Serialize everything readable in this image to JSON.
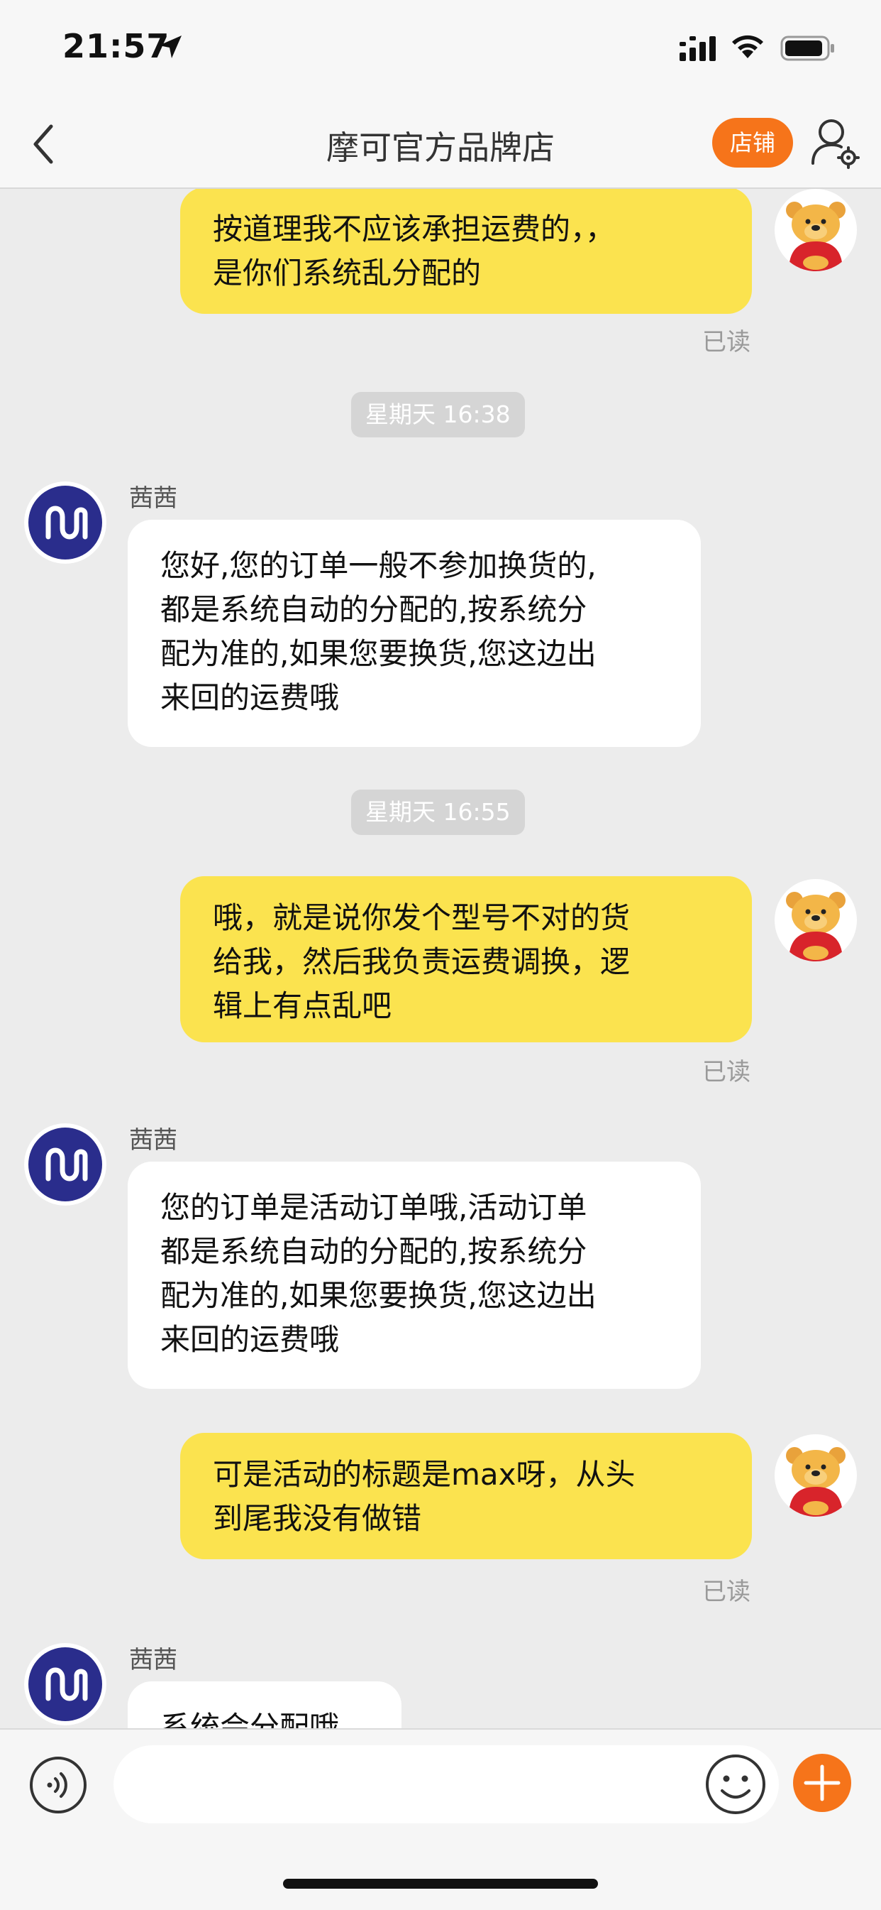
{
  "status_bar": {
    "time": "21:57"
  },
  "nav": {
    "title": "摩可官方品牌店",
    "shop_button": "店铺"
  },
  "messages": [
    {
      "dir": "out",
      "text": "按道理我不应该承担运费的，，\n是你们系统乱分配的",
      "read": "已读"
    },
    {
      "timestamp": "星期天 16:38"
    },
    {
      "dir": "in",
      "sender": "茜茜",
      "text": "您好,您的订单一般不参加换货的,\n都是系统自动的分配的,按系统分\n配为准的,如果您要换货,您这边出\n来回的运费哦"
    },
    {
      "timestamp": "星期天 16:55"
    },
    {
      "dir": "out",
      "text": "哦，就是说你发个型号不对的货\n给我，然后我负责运费调换，逻\n辑上有点乱吧",
      "read": "已读"
    },
    {
      "dir": "in",
      "sender": "茜茜",
      "text": "您的订单是活动订单哦,活动订单\n都是系统自动的分配的,按系统分\n配为准的,如果您要换货,您这边出\n来回的运费哦"
    },
    {
      "dir": "out",
      "text": "可是活动的标题是max呀，从头\n到尾我没有做错",
      "read": "已读"
    },
    {
      "dir": "in",
      "sender": "茜茜",
      "text": "系统会分配哦"
    }
  ],
  "input": {
    "placeholder": ""
  },
  "icons": {
    "back": "chevron-left-icon",
    "user_settings": "user-settings-icon",
    "voice": "voice-icon",
    "emoji": "smiley-icon",
    "plus": "plus-icon",
    "seller_avatar": "wave-logo-icon",
    "user_avatar": "bear-avatar"
  },
  "colors": {
    "accent": "#f6741a",
    "outgoing_bubble": "#fbe34f",
    "seller_logo": "#2a2d8c"
  }
}
